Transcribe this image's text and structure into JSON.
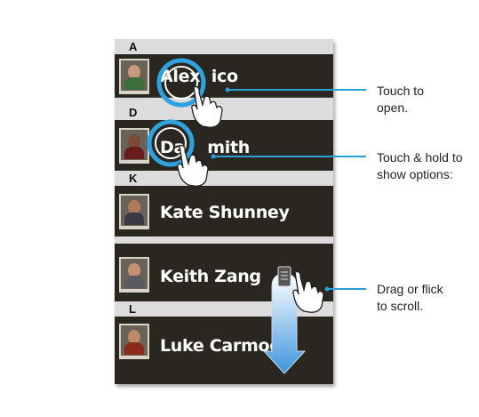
{
  "contacts": {
    "headers": {
      "a": "A",
      "d": "D",
      "k": "K",
      "l": "L"
    },
    "items": [
      {
        "name": "Alex Pico",
        "shown": "Alex  ico"
      },
      {
        "name": "Dan Smith",
        "shown": "Da    mith"
      },
      {
        "name": "Kate Shunney",
        "shown": "Kate Shunney"
      },
      {
        "name": "Keith Zang",
        "shown": "Keith Zang"
      },
      {
        "name": "Luke Carmody",
        "shown": "Luke Carmody"
      }
    ]
  },
  "callouts": {
    "touch": [
      "Touch to",
      "open."
    ],
    "hold": [
      "Touch & hold to",
      "show options:"
    ],
    "drag": [
      "Drag or flick",
      "to scroll."
    ]
  },
  "colors": {
    "list_bg": "#2a2620",
    "header_bg": "#dcdcdc",
    "ring_blue": "#2fa3df",
    "scroll_arrow": "#4a9fe0",
    "leader_line": "#2a9fd8"
  },
  "icons": [
    "touch-ring-icon",
    "hand-pointer-icon",
    "fast-scroll-thumb-icon",
    "scroll-arrow-icon"
  ]
}
